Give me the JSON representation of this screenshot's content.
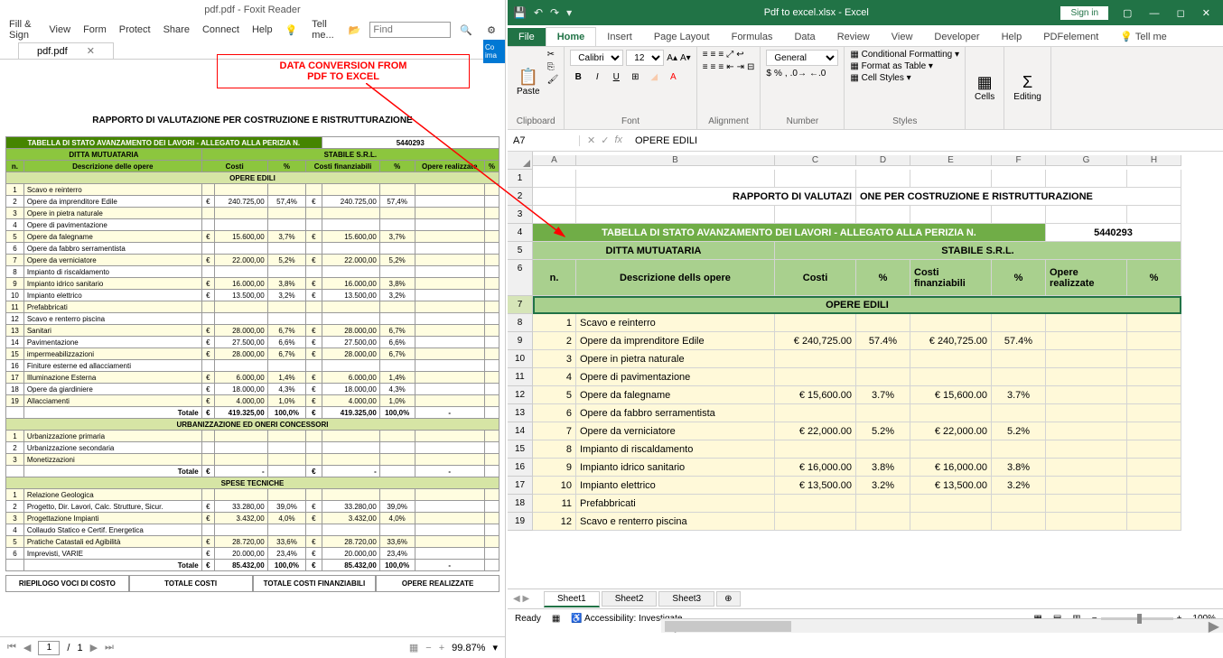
{
  "pdf": {
    "title": "pdf.pdf - Foxit Reader",
    "tab_name": "pdf.pdf",
    "menu": [
      "Fill & Sign",
      "View",
      "Form",
      "Protect",
      "Share",
      "Connect",
      "Help"
    ],
    "tell_me": "Tell me...",
    "find_placeholder": "Find",
    "annotation1": "DATA CONVERSION FROM",
    "annotation2": "PDF TO EXCEL",
    "convert_badge": "Co ima",
    "doc_title": "RAPPORTO DI VALUTAZIONE PER COSTRUZIONE E RISTRUTTURAZIONE",
    "table_header": "TABELLA DI STATO AVANZAMENTO DEI LAVORI - ALLEGATO ALLA PERIZIA N.",
    "perizia_n": "5440293",
    "ditta_label": "DITTA MUTUATARIA",
    "ditta_value": "STABILE S.R.L.",
    "cols": {
      "n": "n.",
      "desc": "Descrizione delle opere",
      "costi": "Costi",
      "pct1": "%",
      "fin": "Costi finanziabili",
      "pct2": "%",
      "real": "Opere realizzate",
      "pct3": "%"
    },
    "sections": {
      "edili": "OPERE EDILI",
      "urb": "URBANIZZAZIONE ED ONERI CONCESSORI",
      "spese": "SPESE TECNICHE"
    },
    "edili_rows": [
      {
        "n": "1",
        "d": "Scavo e reinterro"
      },
      {
        "n": "2",
        "d": "Opere da imprenditore Edile",
        "c": "240.725,00",
        "p1": "57,4%",
        "f": "240.725,00",
        "p2": "57,4%"
      },
      {
        "n": "3",
        "d": "Opere in pietra naturale"
      },
      {
        "n": "4",
        "d": "Opere di pavimentazione"
      },
      {
        "n": "5",
        "d": "Opere da falegname",
        "c": "15.600,00",
        "p1": "3,7%",
        "f": "15.600,00",
        "p2": "3,7%"
      },
      {
        "n": "6",
        "d": "Opere da fabbro serramentista"
      },
      {
        "n": "7",
        "d": "Opere da verniciatore",
        "c": "22.000,00",
        "p1": "5,2%",
        "f": "22.000,00",
        "p2": "5,2%"
      },
      {
        "n": "8",
        "d": "Impianto di riscaldamento"
      },
      {
        "n": "9",
        "d": "Impianto idrico sanitario",
        "c": "16.000,00",
        "p1": "3,8%",
        "f": "16.000,00",
        "p2": "3,8%"
      },
      {
        "n": "10",
        "d": "Impianto elettrico",
        "c": "13.500,00",
        "p1": "3,2%",
        "f": "13.500,00",
        "p2": "3,2%"
      },
      {
        "n": "11",
        "d": "Prefabbricati"
      },
      {
        "n": "12",
        "d": "Scavo e renterro piscina"
      },
      {
        "n": "13",
        "d": "Sanitari",
        "c": "28.000,00",
        "p1": "6,7%",
        "f": "28.000,00",
        "p2": "6,7%"
      },
      {
        "n": "14",
        "d": "Pavimentazione",
        "c": "27.500,00",
        "p1": "6,6%",
        "f": "27.500,00",
        "p2": "6,6%"
      },
      {
        "n": "15",
        "d": "impermeabilizzazioni",
        "c": "28.000,00",
        "p1": "6,7%",
        "f": "28.000,00",
        "p2": "6,7%"
      },
      {
        "n": "16",
        "d": "Finiture esterne ed allacciamenti"
      },
      {
        "n": "17",
        "d": "Illuminazione Esterna",
        "c": "6.000,00",
        "p1": "1,4%",
        "f": "6.000,00",
        "p2": "1,4%"
      },
      {
        "n": "18",
        "d": "Opere da giardiniere",
        "c": "18.000,00",
        "p1": "4,3%",
        "f": "18.000,00",
        "p2": "4,3%"
      },
      {
        "n": "19",
        "d": "Allacciamenti",
        "c": "4.000,00",
        "p1": "1,0%",
        "f": "4.000,00",
        "p2": "1,0%"
      }
    ],
    "edili_total": {
      "label": "Totale",
      "c": "419.325,00",
      "p1": "100,0%",
      "f": "419.325,00",
      "p2": "100,0%",
      "r": "-"
    },
    "urb_rows": [
      {
        "n": "1",
        "d": "Urbanizzazione primaria"
      },
      {
        "n": "2",
        "d": "Urbanizzazione secondaria"
      },
      {
        "n": "3",
        "d": "Monetizzazioni"
      }
    ],
    "urb_total": {
      "label": "Totale",
      "c": "-",
      "f": "-",
      "r": "-"
    },
    "spese_rows": [
      {
        "n": "1",
        "d": "Relazione Geologica"
      },
      {
        "n": "2",
        "d": "Progetto, Dir. Lavori, Calc. Strutture, Sicur.",
        "c": "33.280,00",
        "p1": "39,0%",
        "f": "33.280,00",
        "p2": "39,0%"
      },
      {
        "n": "3",
        "d": "Progettazione Impianti",
        "c": "3.432,00",
        "p1": "4,0%",
        "f": "3.432,00",
        "p2": "4,0%"
      },
      {
        "n": "4",
        "d": "Collaudo Statico e Certif. Energetica"
      },
      {
        "n": "5",
        "d": "Pratiche Catastali ed Agibilità",
        "c": "28.720,00",
        "p1": "33,6%",
        "f": "28.720,00",
        "p2": "33,6%"
      },
      {
        "n": "6",
        "d": "Imprevisti, VARIE",
        "c": "20.000,00",
        "p1": "23,4%",
        "f": "20.000,00",
        "p2": "23,4%"
      }
    ],
    "spese_total": {
      "label": "Totale",
      "c": "85.432,00",
      "p1": "100,0%",
      "f": "85.432,00",
      "p2": "100,0%",
      "r": "-"
    },
    "footer": [
      "RIEPILOGO VOCI DI COSTO",
      "TOTALE COSTI",
      "TOTALE COSTI FINANZIABILI",
      "OPERE REALIZZATE"
    ],
    "page": "1",
    "pages": "1",
    "zoom": "99.87%"
  },
  "xl": {
    "title": "Pdf to excel.xlsx - Excel",
    "signin": "Sign in",
    "tabs": [
      "File",
      "Home",
      "Insert",
      "Page Layout",
      "Formulas",
      "Data",
      "Review",
      "View",
      "Developer",
      "Help",
      "PDFelement"
    ],
    "tell_me": "Tell me",
    "ribbon": {
      "paste": "Paste",
      "clipboard": "Clipboard",
      "font": "Font",
      "alignment": "Alignment",
      "number": "Number",
      "styles": "Styles",
      "cells": "Cells",
      "editing": "Editing",
      "font_name": "Calibri",
      "font_size": "12",
      "num_fmt": "General",
      "cond_fmt": "Conditional Formatting",
      "as_table": "Format as Table",
      "cell_styles": "Cell Styles"
    },
    "name_box": "A7",
    "fx_value": "OPERE EDILI",
    "cols": [
      "A",
      "B",
      "C",
      "D",
      "E",
      "F",
      "G",
      "H"
    ],
    "title_row": {
      "l": "RAPPORTO DI VALUTAZI",
      "r": "ONE PER COSTRUZIONE E RISTRUTTURAZIONE"
    },
    "hdr4": {
      "txt": "TABELLA DI STATO AVANZAMENTO DEI LAVORI - ALLEGATO ALLA PERIZIA N.",
      "n": "5440293"
    },
    "hdr5": {
      "l": "DITTA MUTUATARIA",
      "r": "STABILE S.R.L."
    },
    "hdr6": {
      "n": "n.",
      "desc": "Descrizione dells opere",
      "costi": "Costi",
      "p1": "%",
      "fin": "Costi finanziabili",
      "p2": "%",
      "real": "Opere realizzate",
      "p3": "%"
    },
    "sect7": "OPERE EDILI",
    "data_rows": [
      {
        "r": 8,
        "n": "1",
        "d": "Scavo e reinterro"
      },
      {
        "r": 9,
        "n": "2",
        "d": "Opere da imprenditore Edile",
        "c": "€ 240,725.00",
        "p1": "57.4%",
        "f": "€ 240,725.00",
        "p2": "57.4%"
      },
      {
        "r": 10,
        "n": "3",
        "d": "Opere in pietra naturale"
      },
      {
        "r": 11,
        "n": "4",
        "d": "Opere di pavimentazione"
      },
      {
        "r": 12,
        "n": "5",
        "d": "Opere da falegname",
        "c": "€ 15,600.00",
        "p1": "3.7%",
        "f": "€ 15,600.00",
        "p2": "3.7%"
      },
      {
        "r": 13,
        "n": "6",
        "d": "Opere da fabbro serramentista"
      },
      {
        "r": 14,
        "n": "7",
        "d": "Opere da verniciatore",
        "c": "€ 22,000.00",
        "p1": "5.2%",
        "f": "€ 22,000.00",
        "p2": "5.2%"
      },
      {
        "r": 15,
        "n": "8",
        "d": "Impianto di riscaldamento"
      },
      {
        "r": 16,
        "n": "9",
        "d": "Impianto idrico sanitario",
        "c": "€ 16,000.00",
        "p1": "3.8%",
        "f": "€ 16,000.00",
        "p2": "3.8%"
      },
      {
        "r": 17,
        "n": "10",
        "d": "Impianto elettrico",
        "c": "€ 13,500.00",
        "p1": "3.2%",
        "f": "€ 13,500.00",
        "p2": "3.2%"
      },
      {
        "r": 18,
        "n": "11",
        "d": "Prefabbricati"
      },
      {
        "r": 19,
        "n": "12",
        "d": "Scavo e renterro piscina"
      }
    ],
    "sheets": [
      "Sheet1",
      "Sheet2",
      "Sheet3"
    ],
    "status": {
      "ready": "Ready",
      "access": "Accessibility: Investigate",
      "zoom": "100%"
    }
  }
}
